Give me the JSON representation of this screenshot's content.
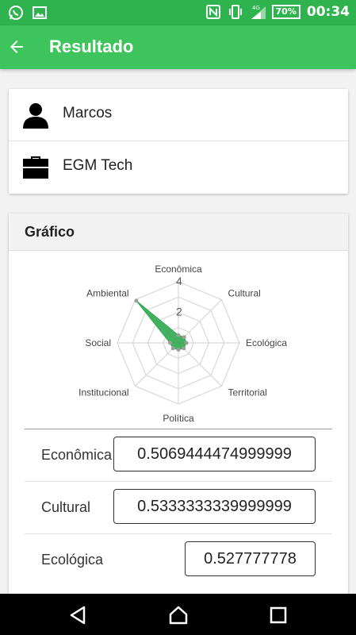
{
  "status_bar": {
    "time": "00:34",
    "battery": "70%",
    "network": "4G",
    "icons": [
      "whatsapp-icon",
      "image-icon",
      "nfc-icon",
      "vibrate-icon",
      "signal-icon",
      "battery-icon"
    ]
  },
  "app_bar": {
    "title": "Resultado",
    "back_icon": "arrow-back-icon"
  },
  "info": {
    "name": "Marcos",
    "company": "EGM Tech",
    "name_icon": "person-icon",
    "company_icon": "briefcase-icon"
  },
  "chart_section": {
    "title": "Gráfico"
  },
  "chart_data": {
    "type": "radar",
    "axes": [
      "Econômica",
      "Cultural",
      "Ecológica",
      "Territorial",
      "Política",
      "Institucional",
      "Social",
      "Ambiental"
    ],
    "tick_labels": [
      "2",
      "4"
    ],
    "rlim": [
      0,
      4
    ],
    "series": [
      {
        "values": [
          0.5069444474999999,
          0.5333333339999999,
          0.527777778,
          0.5,
          0.45,
          0.5,
          0.55,
          3.9
        ],
        "color": "#2fa84f"
      }
    ]
  },
  "results": [
    {
      "label": "Econômica",
      "value": "0.5069444474999999"
    },
    {
      "label": "Cultural",
      "value": "0.5333333339999999"
    },
    {
      "label": "Ecológica",
      "value": "0.527777778"
    }
  ],
  "nav_bar": {
    "icons": [
      "back-triangle-icon",
      "home-icon",
      "recents-square-icon"
    ]
  },
  "colors": {
    "status_bar": "#2fb34f",
    "app_bar": "#3ec45c",
    "series": "#2fa84f"
  }
}
